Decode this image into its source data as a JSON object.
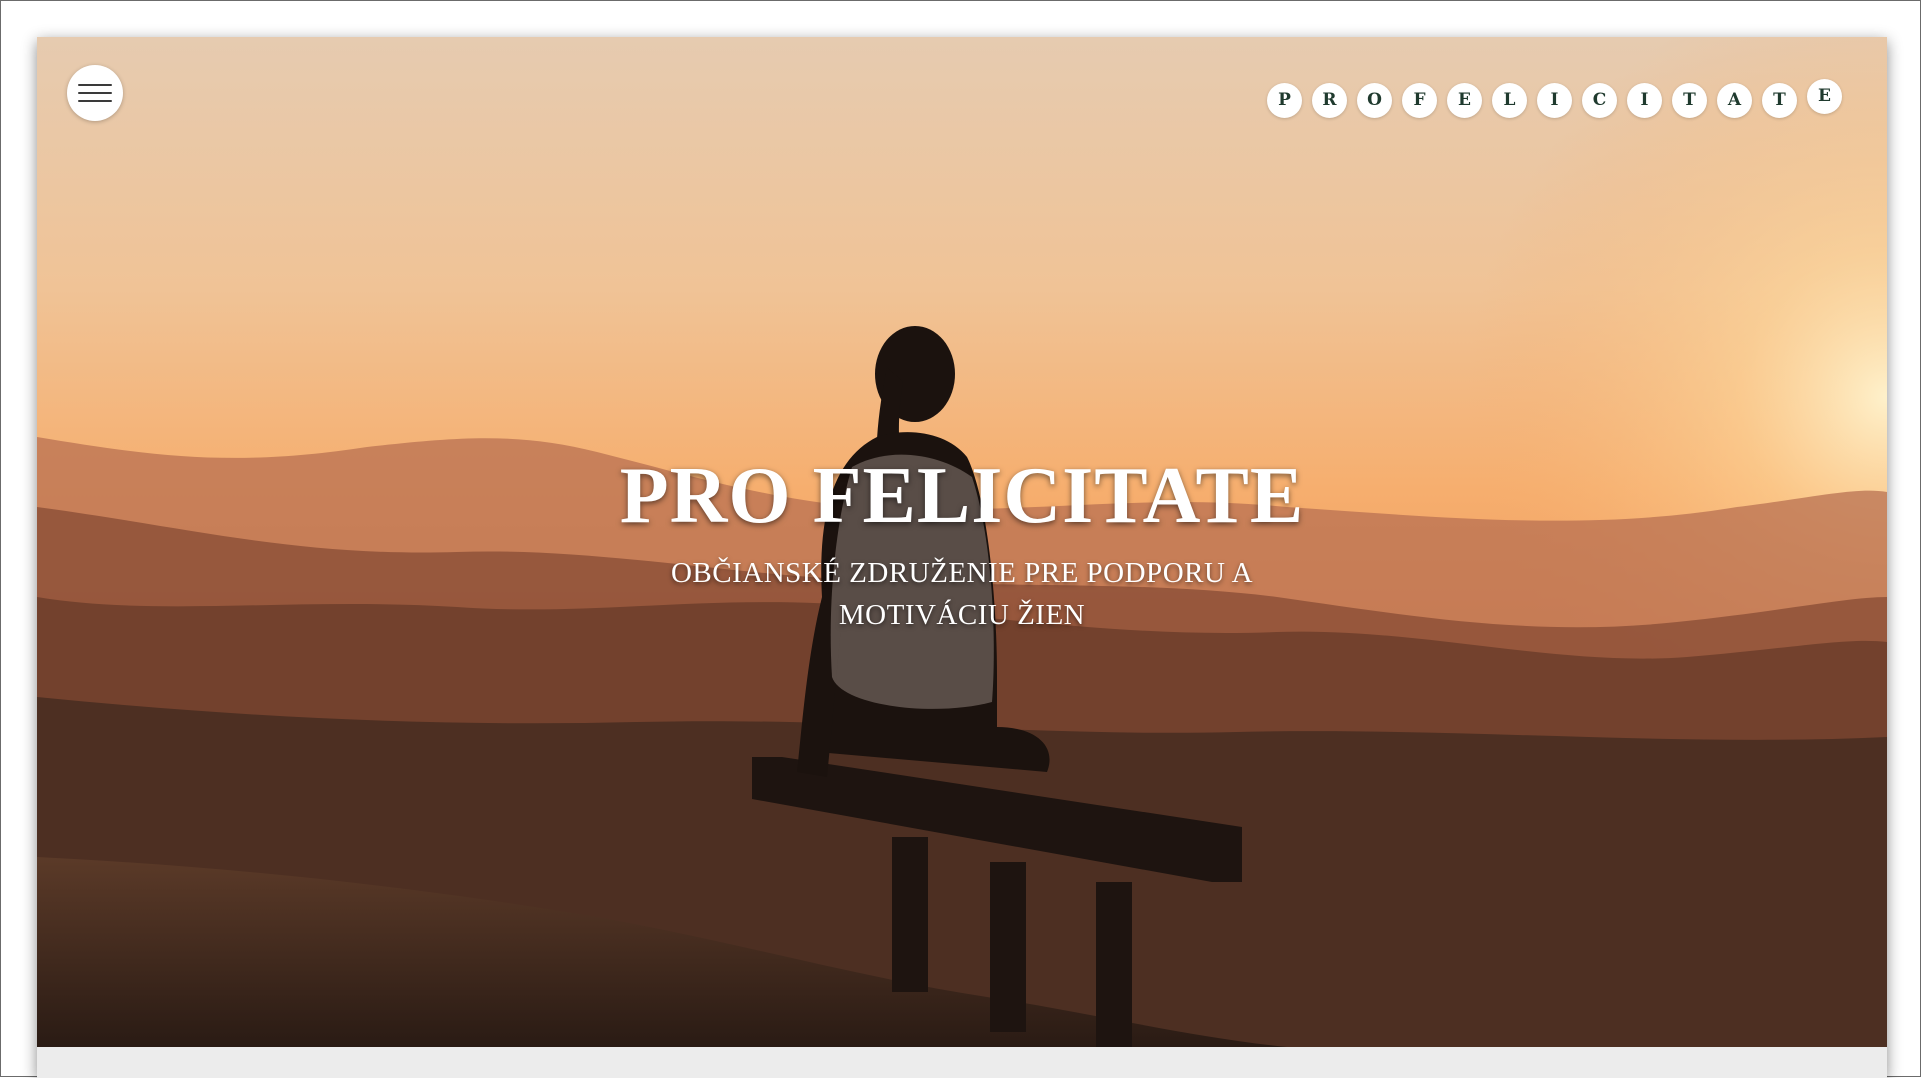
{
  "hero": {
    "title": "PRO FELICITATE",
    "subtitle": "OBČIANSKÉ ZDRUŽENIE PRE PODPORU A MOTIVÁCIU ŽIEN",
    "background_image": "woman-on-bench-sunset"
  },
  "menu": {
    "icon": "hamburger-icon"
  },
  "brand": {
    "letters": [
      "P",
      "R",
      "O",
      "F",
      "E",
      "L",
      "I",
      "C",
      "I",
      "T",
      "A",
      "T",
      "E"
    ],
    "letter_color": "#1f3a2e"
  },
  "colors": {
    "sky_top": "#e7c7a4",
    "sky_horizon": "#f5a862",
    "hills": "#4a2f22",
    "footer_strip": "#ececec"
  }
}
